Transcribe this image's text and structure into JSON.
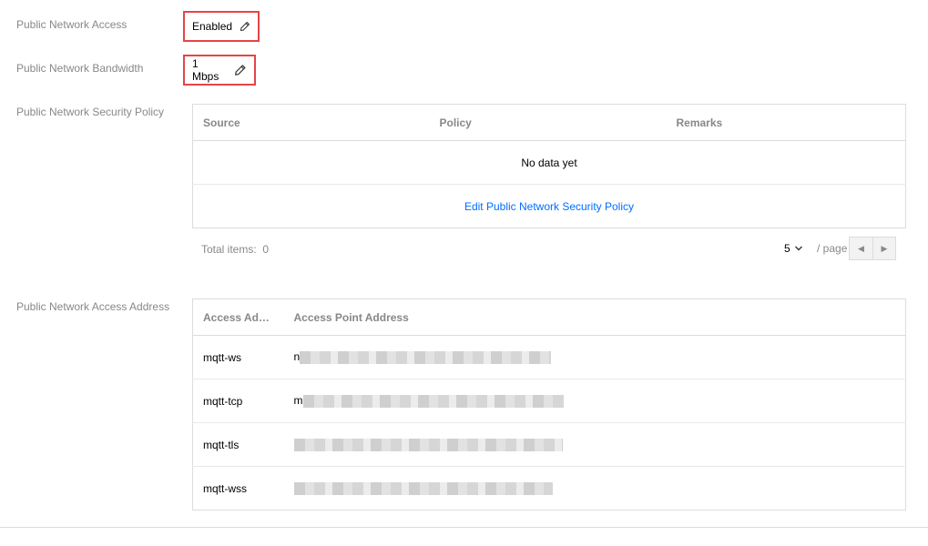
{
  "access": {
    "label": "Public Network Access",
    "value": "Enabled"
  },
  "bandwidth": {
    "label": "Public Network Bandwidth",
    "value": "1 Mbps"
  },
  "security_policy": {
    "label": "Public Network Security Policy",
    "columns": [
      "Source",
      "Policy",
      "Remarks"
    ],
    "empty_text": "No data yet",
    "edit_link": "Edit Public Network Security Policy",
    "pagination": {
      "total_label": "Total items:",
      "total": "0",
      "page_size": "5",
      "per_page": "/ page"
    }
  },
  "access_address": {
    "label": "Public Network Access Address",
    "columns": [
      "Access Ad…",
      "Access Point Address"
    ],
    "rows": [
      {
        "type": "mqtt-ws",
        "prefix": "n"
      },
      {
        "type": "mqtt-tcp",
        "prefix": "m"
      },
      {
        "type": "mqtt-tls",
        "prefix": ""
      },
      {
        "type": "mqtt-wss",
        "prefix": ""
      }
    ]
  },
  "colors": {
    "highlight": "#e54545",
    "link": "#006eff",
    "label": "#888888"
  },
  "icons": {
    "edit": "pencil-icon",
    "dropdown": "chevron-down-icon",
    "prev": "caret-left-icon",
    "next": "caret-right-icon"
  }
}
